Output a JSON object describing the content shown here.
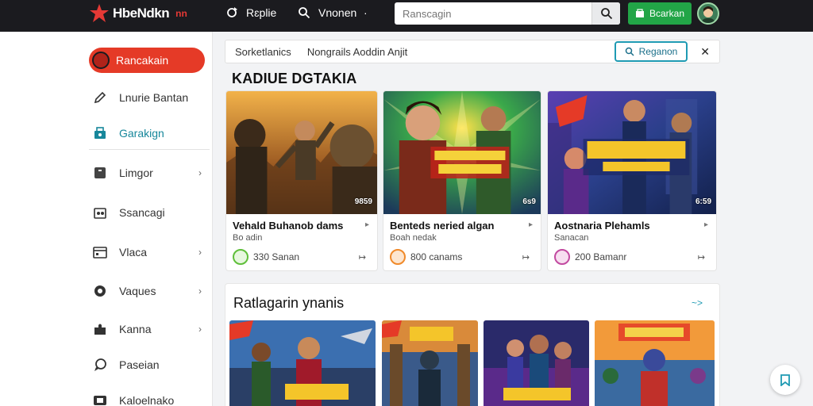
{
  "app": {
    "logo_text": "HbeNdkn",
    "logo_sub": "nn"
  },
  "topbar": {
    "link1": "Rɛplie",
    "link2": "Vnonen",
    "link3_icon": "·",
    "search_placeholder": "Ranscagin",
    "cta_label": "Bcarkan"
  },
  "sidebar": {
    "active_label": "Rancakain",
    "items": [
      {
        "label": "Lnurie Bantan",
        "icon": "pencil-icon"
      },
      {
        "label": "Garakign",
        "icon": "store-icon"
      },
      {
        "label": "Limgor",
        "icon": "square-icon"
      },
      {
        "label": "Ssancagi",
        "icon": "grid-icon"
      },
      {
        "label": "Vlaca",
        "icon": "calendar-icon"
      },
      {
        "label": "Vaques",
        "icon": "circle-icon"
      },
      {
        "label": "Kanna",
        "icon": "puzzle-icon"
      },
      {
        "label": "Paseian",
        "icon": "chat-icon"
      },
      {
        "label": "Kaloelnako",
        "icon": "box-icon"
      }
    ]
  },
  "filter": {
    "seg1": "Sorketlanics",
    "seg2": "Nongrails Aoddin Anjit",
    "search_label": "Reganon",
    "close": "✕"
  },
  "featured": {
    "title": "KADIUE DGTAKIA",
    "cards": [
      {
        "title": "Vehald Buhanob dams",
        "sub": "Bo adin",
        "stat": "330 Sanan",
        "badge": "9859",
        "accent": "#5fbf3a"
      },
      {
        "title": "Benteds neried algan",
        "sub": "Boah nedak",
        "stat": "800 canams",
        "badge": "6s9",
        "accent": "#f08a2a"
      },
      {
        "title": "Aostnaria Plehamls",
        "sub": "Sanacan",
        "stat": "200 Bamanr",
        "badge": "6:59",
        "accent": "#c24aa0"
      }
    ]
  },
  "section2": {
    "title": "Ratlagarin ynanis",
    "more": "~>"
  },
  "colors": {
    "accent_red": "#e53a27",
    "accent_green": "#22a547",
    "accent_teal": "#1f9ab3"
  }
}
